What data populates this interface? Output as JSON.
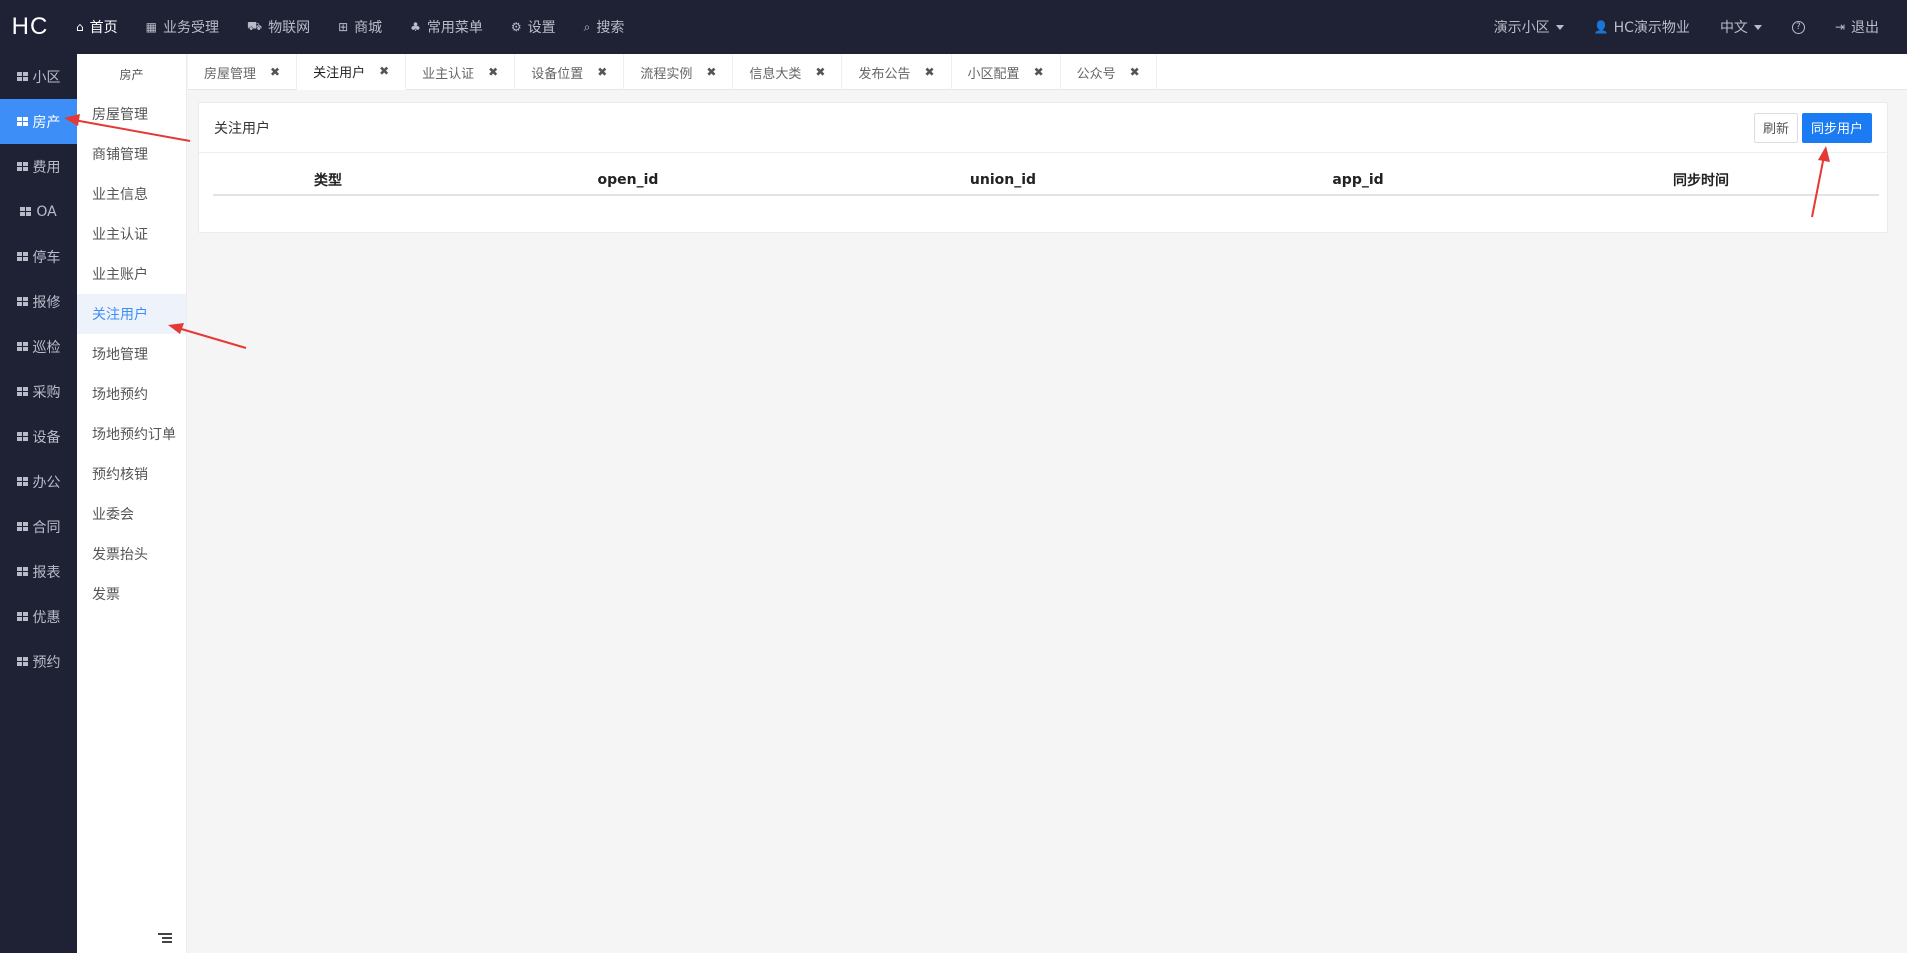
{
  "logo": "HC",
  "topnav": [
    {
      "label": "首页",
      "icon": "home-icon",
      "glyph": "🏠"
    },
    {
      "label": "业务受理",
      "icon": "calculator-icon",
      "glyph": "▦"
    },
    {
      "label": "物联网",
      "icon": "car-icon",
      "glyph": "🚗"
    },
    {
      "label": "商城",
      "icon": "cart-icon",
      "glyph": "🛒"
    },
    {
      "label": "常用菜单",
      "icon": "sitemap-icon",
      "glyph": "♣"
    },
    {
      "label": "设置",
      "icon": "gear-icon",
      "glyph": "⚙"
    },
    {
      "label": "搜索",
      "icon": "search-icon",
      "glyph": "🔍"
    }
  ],
  "topright": {
    "community": "演示小区",
    "user": "HC演示物业",
    "lang": "中文",
    "help": "?",
    "logout": "退出"
  },
  "sidebar": [
    "小区",
    "房产",
    "费用",
    "OA",
    "停车",
    "报修",
    "巡检",
    "采购",
    "设备",
    "办公",
    "合同",
    "报表",
    "优惠",
    "预约"
  ],
  "submenu": {
    "head": "房产",
    "items": [
      "房屋管理",
      "商铺管理",
      "业主信息",
      "业主认证",
      "业主账户",
      "关注用户",
      "场地管理",
      "场地预约",
      "场地预约订单",
      "预约核销",
      "业委会",
      "发票抬头",
      "发票"
    ]
  },
  "tabs": [
    "房屋管理",
    "关注用户",
    "业主认证",
    "设备位置",
    "流程实例",
    "信息大类",
    "发布公告",
    "小区配置",
    "公众号"
  ],
  "panel": {
    "title": "关注用户",
    "refresh": "刷新",
    "sync": "同步用户",
    "columns": [
      "类型",
      "open_id",
      "union_id",
      "app_id",
      "同步时间"
    ]
  },
  "colors": {
    "accent": "#3e8ef7",
    "dark": "#1f2235",
    "primary_btn": "#1a7bf2",
    "annotation": "#e53935"
  }
}
